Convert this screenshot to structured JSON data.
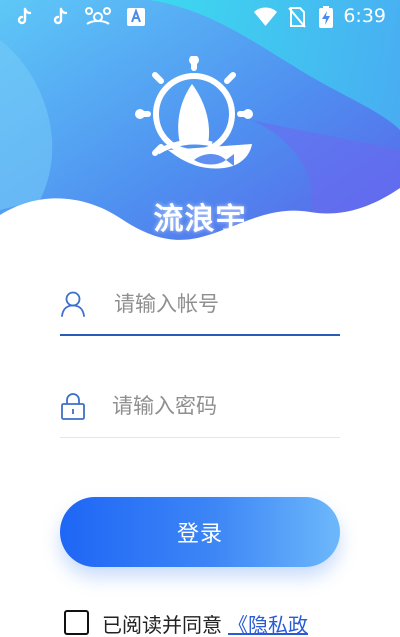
{
  "status_bar": {
    "time": "6:39",
    "icons": [
      "tiktok-icon",
      "tiktok-icon",
      "network-icon",
      "translate-icon",
      "wifi-icon",
      "no-sim-icon",
      "battery-charging-icon"
    ]
  },
  "brand": {
    "name": "流浪宇"
  },
  "colors": {
    "accent": "#1e66f5",
    "link": "#2a5bd7",
    "header_start": "#4fd6f0",
    "header_end": "#5a5ee8"
  },
  "form": {
    "account_placeholder": "请输入帐号",
    "password_placeholder": "请输入密码",
    "login_label": "登录"
  },
  "agreement": {
    "text": "已阅读并同意",
    "link": "《隐私政"
  }
}
